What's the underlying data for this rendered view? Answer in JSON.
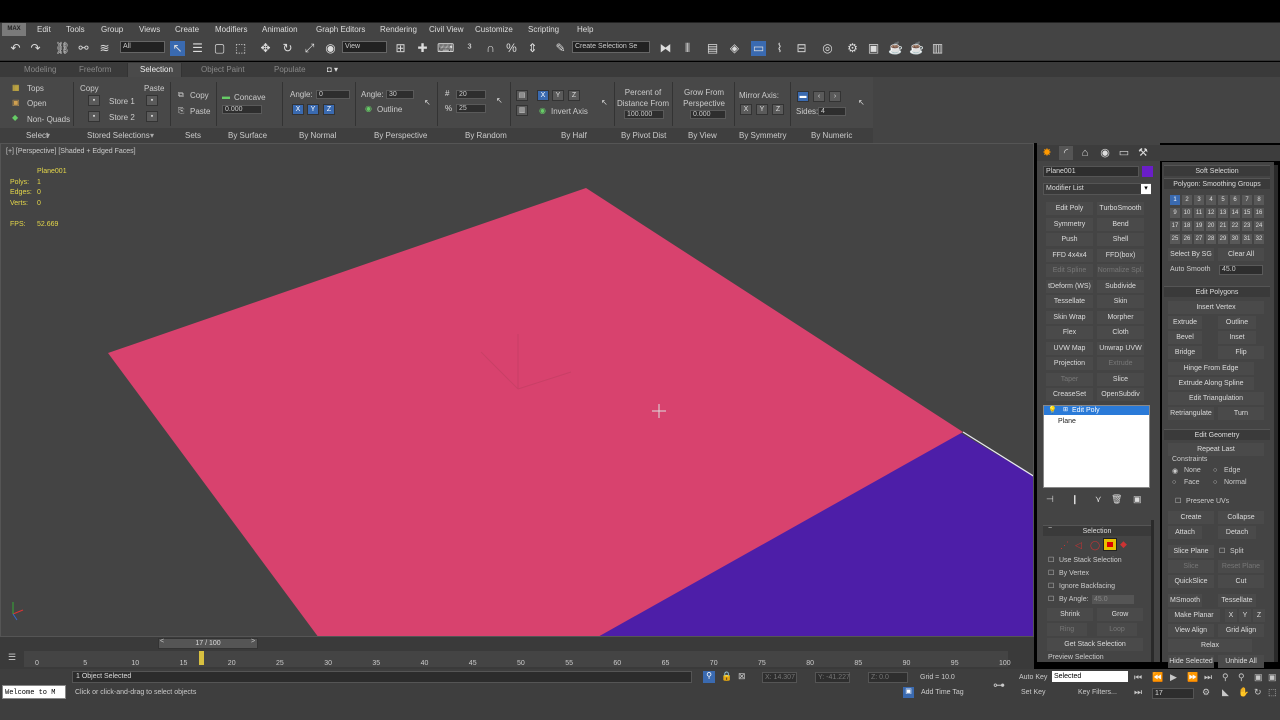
{
  "app": {
    "icon_text": "MAX"
  },
  "menu": [
    "Edit",
    "Tools",
    "Group",
    "Views",
    "Create",
    "Modifiers",
    "Animation",
    "Graph Editors",
    "Rendering",
    "Civil View",
    "Customize",
    "Scripting",
    "Help"
  ],
  "toolbar": {
    "filter_value": "All",
    "view_value": "View",
    "selection_set_placeholder": "Create Selection Se"
  },
  "ribbon": {
    "tabs": [
      "Modeling",
      "Freeform",
      "Selection",
      "Object Paint",
      "Populate"
    ],
    "active_tab": "Selection",
    "tops_label": "Tops",
    "open_label": "Open",
    "nonquads_label": "Non- Quads",
    "copy_label": "Copy",
    "paste_label": "Paste",
    "store1": "Store 1",
    "store2": "Store 2",
    "copy2": "Copy",
    "paste2": "Paste",
    "concave": "Concave",
    "concave_val": "0.000",
    "angle1_label": "Angle:",
    "angle1_val": "0",
    "angle2_label": "Angle:",
    "angle2_val": "30",
    "outline": "Outline",
    "spin_a": "20",
    "spin_b": "25",
    "invert_axis": "Invert Axis",
    "percent_label": "Percent of Distance From",
    "percent_val": "100.000",
    "grow_label": "Grow From Perspective View",
    "grow_val": "0.000",
    "mirror_label": "Mirror Axis:",
    "sides_label": "Sides:",
    "sides_val": "4",
    "footer": [
      "Select",
      "Stored Selections",
      "Sets",
      "By Surface",
      "By Normal",
      "By Perspective",
      "By Random",
      "By Half",
      "By Pivot Dist",
      "By View",
      "By Symmetry",
      "By Numeric"
    ]
  },
  "viewport": {
    "label": "[+] [Perspective] [Shaded + Edged Faces]",
    "object_name": "Plane001",
    "stats": [
      {
        "k": "Polys:",
        "v": "1"
      },
      {
        "k": "Edges:",
        "v": "0"
      },
      {
        "k": "Verts:",
        "v": "0"
      }
    ],
    "fps_label": "FPS:",
    "fps_val": "52.669",
    "colors": {
      "plane": "#d8426e",
      "purple": "#4d1ea8",
      "bg": "#444444"
    }
  },
  "command_panel": {
    "object_name": "Plane001",
    "modifier_list": "Modifier List",
    "buttons": [
      [
        "Edit Poly",
        "TurboSmooth"
      ],
      [
        "Symmetry",
        "Bend"
      ],
      [
        "Push",
        "Shell"
      ],
      [
        "FFD 4x4x4",
        "FFD(box)"
      ],
      [
        "Edit Spline",
        "Normalize Spl."
      ],
      [
        "tDeform (WS)",
        "Subdivide"
      ],
      [
        "Tessellate",
        "Skin"
      ],
      [
        "Skin Wrap",
        "Morpher"
      ],
      [
        "Flex",
        "Cloth"
      ],
      [
        "UVW Map",
        "Unwrap UVW"
      ],
      [
        "Projection",
        "Extrude"
      ],
      [
        "Taper",
        "Slice"
      ],
      [
        "CreaseSet",
        "OpenSubdiv"
      ]
    ],
    "dim": [
      "Edit Spline",
      "Normalize Spl.",
      "Extrude",
      "Taper"
    ],
    "stack": [
      "Edit Poly",
      "Plane"
    ],
    "selection_title": "Selection",
    "selection_options": [
      "Use Stack Selection",
      "By Vertex",
      "Ignore Backfacing",
      "By Angle:"
    ],
    "by_angle_val": "45.0",
    "shrink": "Shrink",
    "grow": "Grow",
    "ring": "Ring",
    "loop": "Loop",
    "get_stack": "Get Stack Selection",
    "preview": "Preview Selection"
  },
  "right_rollout": {
    "soft_selection": "Soft Selection",
    "smoothing_groups": "Polygon: Smoothing Groups",
    "sg_numbers": [
      "1",
      "2",
      "3",
      "4",
      "5",
      "6",
      "7",
      "8",
      "9",
      "10",
      "11",
      "12",
      "13",
      "14",
      "15",
      "16",
      "17",
      "18",
      "19",
      "20",
      "21",
      "22",
      "23",
      "24",
      "25",
      "26",
      "27",
      "28",
      "29",
      "30",
      "31",
      "32"
    ],
    "select_by_sg": "Select By SG",
    "clear_all": "Clear All",
    "auto_smooth": "Auto Smooth",
    "auto_smooth_val": "45.0",
    "edit_polygons": "Edit Polygons",
    "insert_vertex": "Insert Vertex",
    "ep_buttons": [
      [
        "Extrude",
        "Outline"
      ],
      [
        "Bevel",
        "Inset"
      ],
      [
        "Bridge",
        "Flip"
      ]
    ],
    "hinge": "Hinge From Edge",
    "extrude_spline": "Extrude Along Spline",
    "edit_tri": "Edit Triangulation",
    "retriangulate": "Retriangulate",
    "turn": "Turn",
    "edit_geometry": "Edit Geometry",
    "repeat_last": "Repeat Last",
    "constraints": "Constraints",
    "c_none": "None",
    "c_edge": "Edge",
    "c_face": "Face",
    "c_normal": "Normal",
    "preserve_uvs": "Preserve UVs",
    "create": "Create",
    "collapse": "Collapse",
    "attach": "Attach",
    "detach": "Detach",
    "slice_plane": "Slice Plane",
    "split": "Split",
    "slice": "Slice",
    "reset_plane": "Reset Plane",
    "quickslice": "QuickSlice",
    "cut": "Cut",
    "msmooth": "MSmooth",
    "tessellate": "Tessellate",
    "make_planar": "Make Planar",
    "x": "X",
    "y": "Y",
    "z": "Z",
    "view_align": "View Align",
    "grid_align": "Grid Align",
    "relax": "Relax",
    "hide_selected": "Hide Selected",
    "unhide_all": "Unhide All"
  },
  "timeline": {
    "frame": "17 / 100",
    "ticks": [
      "0",
      "5",
      "10",
      "15",
      "20",
      "25",
      "30",
      "35",
      "40",
      "45",
      "50",
      "55",
      "60",
      "65",
      "70",
      "75",
      "80",
      "85",
      "90",
      "95",
      "100"
    ]
  },
  "status": {
    "listener": "Welcome to M",
    "selected": "1 Object Selected",
    "prompt": "Click or click-and-drag to select objects",
    "x": "X: 14.307",
    "y": "Y: -41.227",
    "z": "Z: 0.0",
    "grid": "Grid = 10.0",
    "add_time_tag": "Add Time Tag",
    "auto_key": "Auto Key",
    "set_key": "Set Key",
    "selected_dd": "Selected",
    "key_filters": "Key Filters...",
    "frame_val": "17"
  }
}
